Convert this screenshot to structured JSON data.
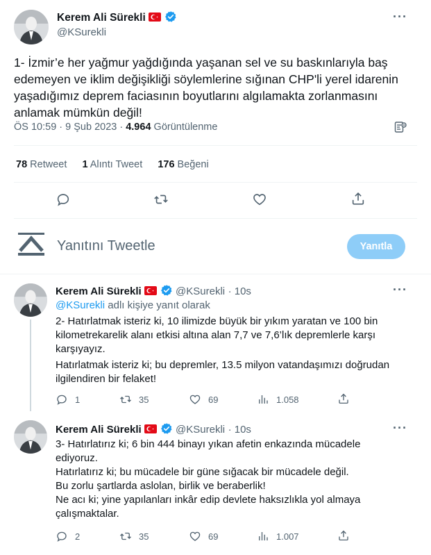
{
  "main_tweet": {
    "author_name": "Kerem Ali Sürekli",
    "author_handle": "@KSurekli",
    "text": "1- İzmir’e her yağmur yağdığında yaşanan sel ve su baskınlarıyla baş edemeyen ve iklim değişikliği söylemlerine sığınan CHP'li yerel idarenin yaşadığımız deprem faciasının boyutlarını algılamakta zorlanmasını anlamak mümkün değil!",
    "lines": [
      "1- İzmir’e her yağmur yağdığında yaşanan sel ve su baskınlarıyla baş",
      "edemeyen ve iklim değişikliği söylemlerine sığınan CHP'li yerel idarenin",
      "yaşadığımız deprem faciasının boyutlarını algılamakta zorlanmasını",
      "anlamak mümkün değil!"
    ],
    "timestamp": "ÖS 10:59 · 9 Şub 2023 ·",
    "views_count": "4.964",
    "views_label": "Görüntülenme",
    "retweets_count": "78",
    "retweets_label": "Retweet",
    "quotes_count": "1",
    "quotes_label": "Alıntı Tweet",
    "likes_count": "176",
    "likes_label": "Beğeni"
  },
  "compose": {
    "placeholder": "Yanıtını Tweetle",
    "reply_button": "Yanıtla"
  },
  "replies": [
    {
      "author_name": "Kerem Ali Sürekli",
      "author_handle": "@KSurekli",
      "time": "· 10s",
      "replying_to_handle": "@KSurekli",
      "replying_to_suffix": "adlı kişiye yanıt olarak",
      "lines": [
        "2- Hatırlatmak isteriz ki, 10 ilimizde büyük bir yıkım yaratan ve 100 bin",
        "kilometrekarelik alanı etkisi altına alan 7,7 ve 7,6’lık depremlerle karşı",
        "karşıyayız.",
        "Hatırlatmak isteriz ki; bu depremler, 13.5 milyon vatandaşımızı doğrudan",
        "ilgilendiren bir felaket!"
      ],
      "reply_count": "1",
      "retweet_count": "35",
      "like_count": "69",
      "view_count": "1.058"
    },
    {
      "author_name": "Kerem Ali Sürekli",
      "author_handle": "@KSurekli",
      "time": "· 10s",
      "lines": [
        "3- Hatırlatırız ki; 6 bin 444 binayı yıkan afetin enkazında mücadele",
        "ediyoruz.",
        "Hatırlatırız ki; bu mücadele bir güne sığacak bir mücadele değil.",
        "Bu zorlu şartlarda aslolan, birlik ve beraberlik!",
        "Ne acı ki; yine yapılanları inkâr edip devlete haksızlıkla yol almaya",
        "çalışmaktalar."
      ],
      "reply_count": "2",
      "retweet_count": "35",
      "like_count": "69",
      "view_count": "1.007"
    }
  ],
  "colors": {
    "accent": "#1d9bf0",
    "reply_button_bg": "#8ecdf8",
    "muted": "#536471",
    "verified": "#1d9bf0",
    "flag": "#e30a17"
  }
}
